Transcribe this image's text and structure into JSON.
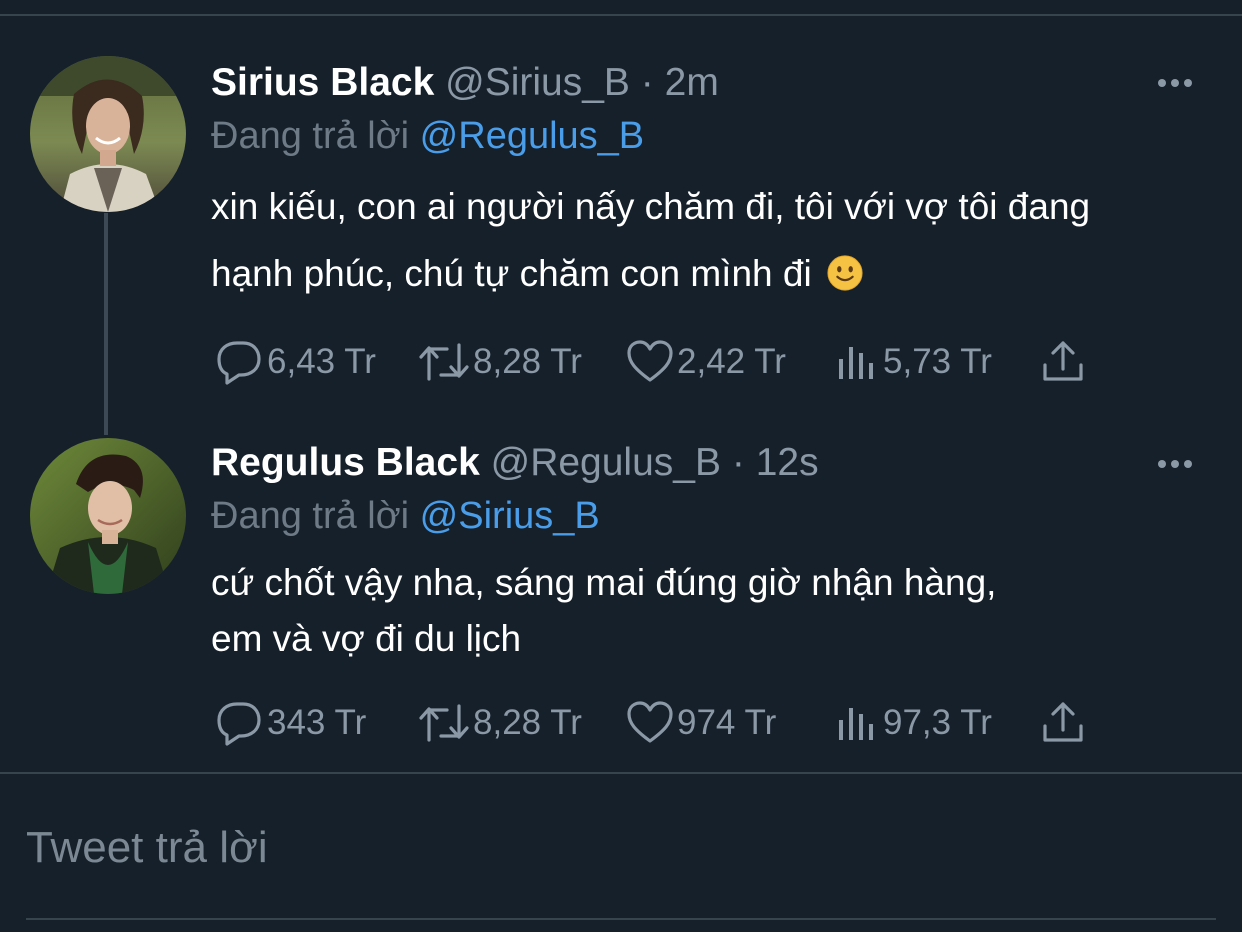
{
  "thread": [
    {
      "display_name": "Sirius Black",
      "handle": "@Sirius_B",
      "separator": "·",
      "time": "2m",
      "reply_prefix": "Đang trả lời",
      "reply_to": "@Regulus_B",
      "text": "xin kiếu, con ai người nấy chăm đi, tôi với vợ tôi đang hạnh phúc, chú tự chăm con mình đi",
      "emoji": "slightly-smiling-face",
      "stats": {
        "replies": "6,43 Tr",
        "retweets": "8,28 Tr",
        "likes": "2,42 Tr",
        "views": "5,73 Tr"
      }
    },
    {
      "display_name": "Regulus Black",
      "handle": "@Regulus_B",
      "separator": "·",
      "time": "12s",
      "reply_prefix": "Đang trả lời",
      "reply_to": "@Sirius_B",
      "text_line_1": "cứ chốt vậy nha, sáng mai đúng giờ nhận hàng,",
      "text_line_2": "em và vợ đi du lịch",
      "stats": {
        "replies": "343 Tr",
        "retweets": "8,28 Tr",
        "likes": "974 Tr",
        "views": "97,3 Tr"
      }
    }
  ],
  "reply_box": {
    "placeholder": "Tweet trả lời"
  },
  "icons": {
    "reply": "reply-icon",
    "retweet": "retweet-icon",
    "like": "heart-icon",
    "views": "views-icon",
    "share": "share-icon",
    "more": "more-icon"
  },
  "colors": {
    "background": "#15202b",
    "mention": "#4a9de8",
    "secondary_text": "#8b98a5",
    "divider": "#38444d"
  }
}
